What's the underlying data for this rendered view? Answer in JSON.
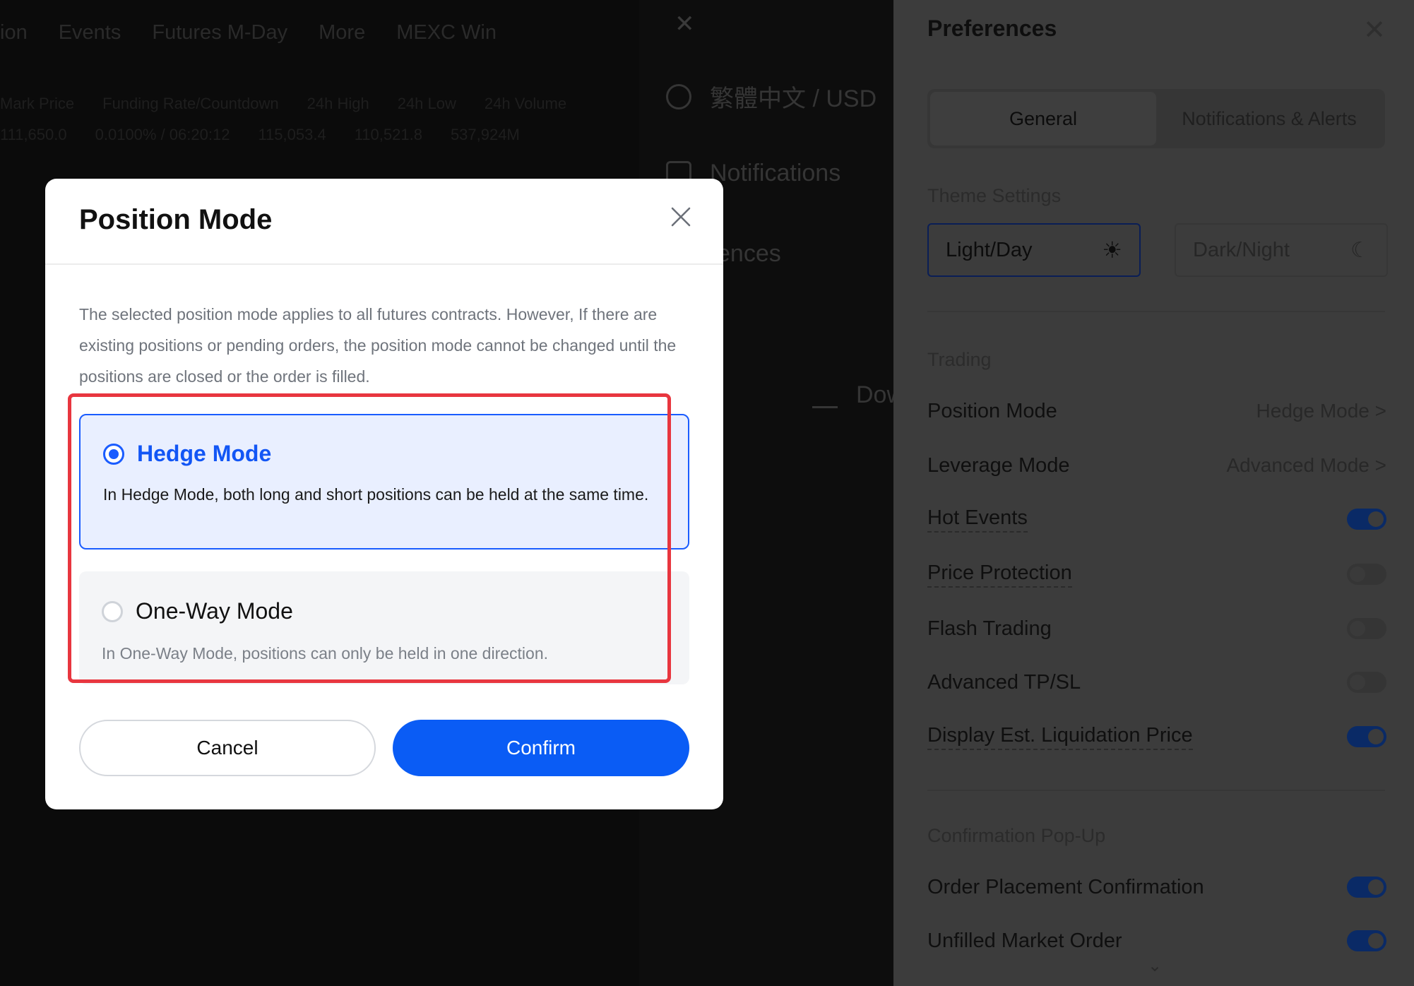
{
  "background": {
    "nav": [
      "ion",
      "Events",
      "Futures M-Day",
      "More",
      "MEXC Win"
    ],
    "row1": [
      "Mark Price",
      "Funding Rate/Countdown",
      "24h High",
      "24h Low",
      "24h Volume"
    ],
    "row2": [
      "111,650.0",
      "0.0100% / 06:20:12",
      "115,053.4",
      "110,521.8",
      "537,924M"
    ]
  },
  "middle_menu": {
    "language": "繁體中文 / USD",
    "notifications": "Notifications",
    "preferences_partial": "ences",
    "download_partial": "Dow"
  },
  "preferences": {
    "title": "Preferences",
    "tabs": [
      {
        "label": "General",
        "active": true
      },
      {
        "label": "Notifications & Alerts",
        "active": false
      }
    ],
    "theme_settings_label": "Theme Settings",
    "theme_light": "Light/Day",
    "theme_dark": "Dark/Night",
    "trading_label": "Trading",
    "rows": [
      {
        "label": "Position Mode",
        "value": "Hedge Mode >"
      },
      {
        "label": "Leverage Mode",
        "value": "Advanced Mode >"
      },
      {
        "label": "Hot Events",
        "on": true
      },
      {
        "label": "Price Protection",
        "on": false
      },
      {
        "label": "Flash Trading",
        "on": false
      },
      {
        "label": "Advanced TP/SL",
        "on": false
      },
      {
        "label": "Display Est. Liquidation Price",
        "on": true
      }
    ],
    "confirmation_label": "Confirmation Pop-Up",
    "confirm_rows": [
      {
        "label": "Order Placement Confirmation",
        "on": true
      },
      {
        "label": "Unfilled Market Order",
        "on": true
      }
    ]
  },
  "modal": {
    "title": "Position Mode",
    "description": "The selected position mode applies to all futures contracts. However, If there are existing positions or pending orders, the position mode cannot be changed until the positions are closed or the order is filled.",
    "options": [
      {
        "title": "Hedge Mode",
        "description": "In Hedge Mode, both long and short positions can be held at the same time.",
        "selected": true
      },
      {
        "title": "One-Way Mode",
        "description": "In One-Way Mode, positions can only be held in one direction.",
        "selected": false
      }
    ],
    "cancel_label": "Cancel",
    "confirm_label": "Confirm"
  },
  "colors": {
    "accent": "#0a5cf5",
    "highlight": "#e8363f",
    "selected_bg": "#e9efff"
  }
}
